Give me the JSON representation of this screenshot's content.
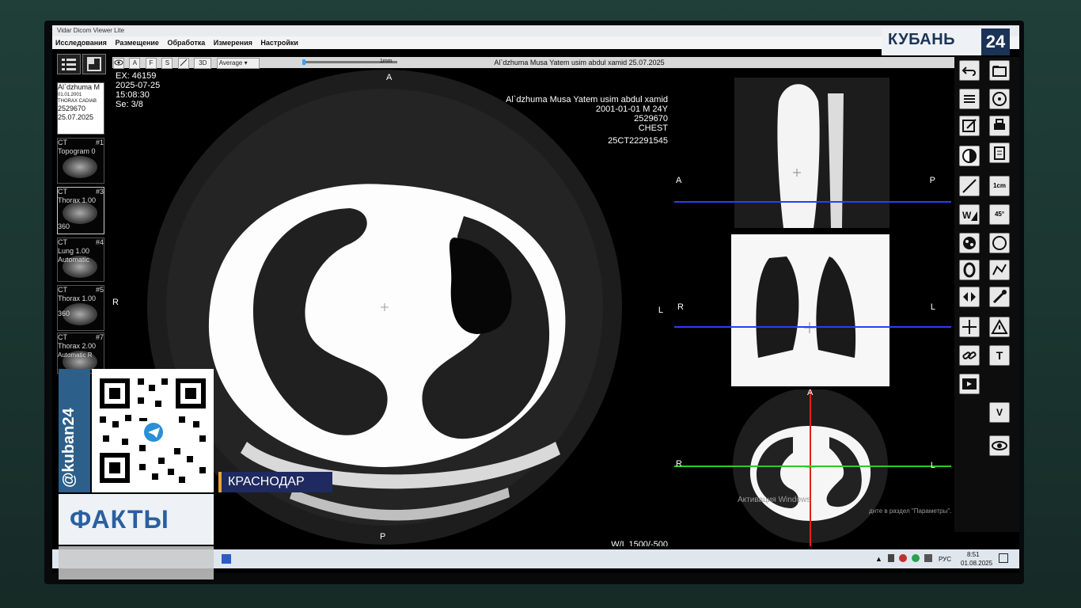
{
  "app": {
    "window_title": "Vidar Dicom Viewer Lite",
    "menu": [
      "Исследования",
      "Размещение",
      "Обработка",
      "Измерения",
      "Настройки"
    ]
  },
  "toolbar": {
    "buttons": [
      "A",
      "F",
      "S",
      "3D"
    ],
    "render_mode": "Average",
    "slider_label": "1mm",
    "patient_header": "Al`dzhuma Musa Yatem usim abdul xamid  25.07.2025"
  },
  "series_panel": {
    "info_card": [
      "Al`dzhuma M",
      "01.01.2001",
      "THORAX CADIAB",
      "2529670",
      "25.07.2025"
    ],
    "series": [
      {
        "modality": "CT",
        "number": "#1",
        "name": "Topogram",
        "extra": "0"
      },
      {
        "modality": "CT",
        "number": "#3",
        "name": "Thorax 1.00",
        "extra": "360"
      },
      {
        "modality": "CT",
        "number": "#4",
        "name": "Lung 1.00",
        "extra": "Automatic"
      },
      {
        "modality": "CT",
        "number": "#5",
        "name": "Thorax 1.00",
        "extra": "360"
      },
      {
        "modality": "CT",
        "number": "#7",
        "name": "Thorax 2.00",
        "extra": "Automatic R"
      }
    ]
  },
  "main_view": {
    "top_left": [
      "EX: 46159",
      "2025-07-25",
      "15:08:30",
      "Se: 3/8"
    ],
    "top_right": [
      "Al`dzhuma Musa Yatem usim abdul xamid",
      "2001-01-01 M  24Y",
      "2529670",
      "CHEST",
      "25CT22291545"
    ],
    "orientation": {
      "top": "A",
      "bottom": "P",
      "left": "R",
      "right": "L"
    },
    "window_level": "W/L 1500/-500"
  },
  "right_views": {
    "sagittal": {
      "left": "A",
      "right": "P"
    },
    "coronal": {
      "left": "R",
      "right": "L"
    },
    "axial": {
      "top": "A",
      "left": "R",
      "right": "L"
    },
    "activation_text": "Активация Windows",
    "activation_sub": "дите в раздел \"Параметры\"."
  },
  "right_toolbar": {
    "icons": [
      "undo-icon",
      "folder-icon",
      "layers-icon",
      "disc-icon",
      "edit-icon",
      "print-icon",
      "contrast-icon",
      "clipboard-icon",
      "ruler-line-icon",
      "one-cm-icon",
      "wl-icon",
      "angle-icon",
      "mask-icon",
      "circle-roi-icon",
      "ellipse-icon",
      "polyline-icon",
      "flip-icon",
      "pipette-icon",
      "crosshair-icon",
      "warning-icon",
      "link-icon",
      "text-icon",
      "video-icon",
      "v-marker-icon",
      "eye-icon"
    ],
    "one_cm_label": "1cm",
    "angle_label": "45°",
    "text_label": "T",
    "v_label": "V"
  },
  "taskbar": {
    "lang": "РУС",
    "time": "8:51",
    "date": "01.08.2025"
  },
  "broadcast": {
    "channel": "КУБАНЬ",
    "channel_num": "24",
    "handle": "@kuban24",
    "program": "ФАКТЫ",
    "city": "КРАСНОДАР"
  }
}
